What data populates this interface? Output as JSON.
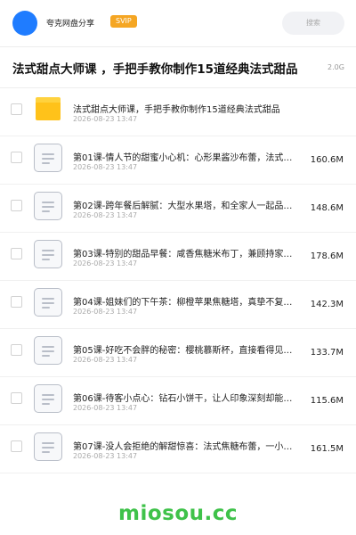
{
  "header": {
    "site_name": "夸克网盘分享",
    "svip_badge": "SVIP",
    "search_placeholder": "搜索"
  },
  "share": {
    "title": "法式甜点大师课 ，手把手教你制作15道经典法式甜品",
    "total_size": "2.0G"
  },
  "files": [
    {
      "type": "folder",
      "icon": "folder-icon",
      "name": "法式甜点大师课，手把手教你制作15道经典法式甜品",
      "date": "2026-08-23 13:47",
      "size": ""
    },
    {
      "type": "file",
      "icon": "document-icon",
      "name": "第01课-情人节的甜蜜小心机：心形果酱沙布蕾，法式…",
      "date": "2026-08-23 13:47",
      "size": "160.6M"
    },
    {
      "type": "file",
      "icon": "document-icon",
      "name": "第02课-跨年餐后解腻：大型水果塔，和全家人一起品…",
      "date": "2026-08-23 13:47",
      "size": "148.6M"
    },
    {
      "type": "file",
      "icon": "document-icon",
      "name": "第03课-特别的甜品早餐：咸香焦糖米布丁，兼顾持家…",
      "date": "2026-08-23 13:47",
      "size": "178.6M"
    },
    {
      "type": "file",
      "icon": "document-icon",
      "name": "第04课-姐妹们的下午茶：柳橙苹果焦糖塔，真挚不复…",
      "date": "2026-08-23 13:47",
      "size": "142.3M"
    },
    {
      "type": "file",
      "icon": "document-icon",
      "name": "第05课-好吃不会胖的秘密：樱桃慕斯杯，直接看得见…",
      "date": "2026-08-23 13:47",
      "size": "133.7M"
    },
    {
      "type": "file",
      "icon": "document-icon",
      "name": "第06课-待客小点心：钻石小饼干，让人印象深刻却能…",
      "date": "2026-08-23 13:47",
      "size": "115.6M"
    },
    {
      "type": "file",
      "icon": "document-icon",
      "name": "第07课-没人会拒绝的解甜惊喜：法式焦糖布蕾，一小…",
      "date": "2026-08-23 13:47",
      "size": "161.5M"
    }
  ],
  "footer": {
    "watermark": "miosou.cc"
  },
  "colors": {
    "brand_blue": "#1f7cff",
    "svip_orange": "#f5a623",
    "folder_yellow": "#ffc21a",
    "watermark_green": "#3fc24a"
  }
}
